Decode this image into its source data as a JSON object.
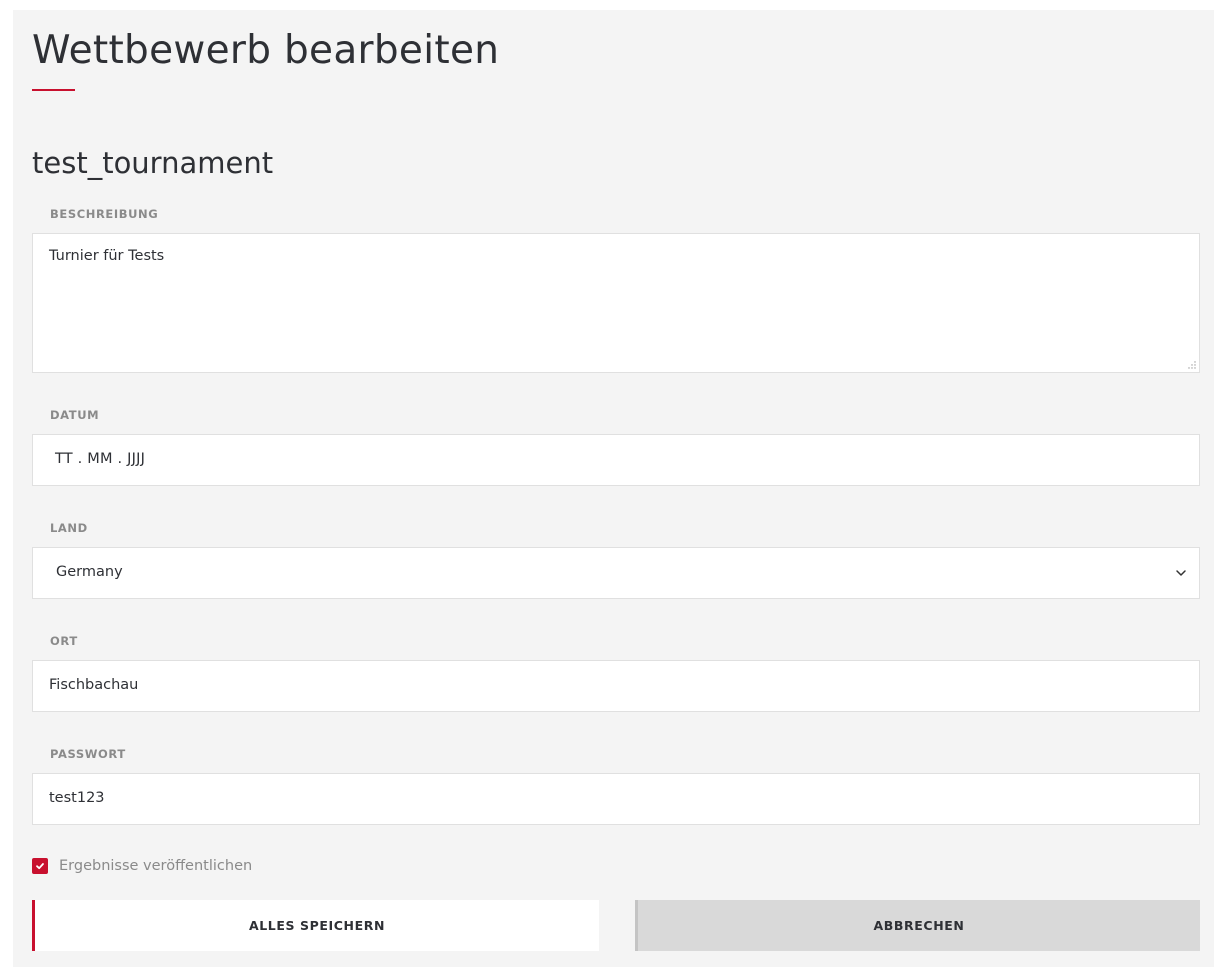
{
  "header": {
    "title": "Wettbewerb bearbeiten"
  },
  "form": {
    "name": "test_tournament",
    "description": {
      "label": "BESCHREIBUNG",
      "value": "Turnier für Tests"
    },
    "date": {
      "label": "DATUM",
      "placeholder": "TT . MM . JJJJ"
    },
    "country": {
      "label": "LAND",
      "selected": "Germany"
    },
    "city": {
      "label": "ORT",
      "value": "Fischbachau"
    },
    "password": {
      "label": "PASSWORT",
      "value": "test123"
    },
    "publish_results": {
      "label": "Ergebnisse veröffentlichen",
      "checked": true
    }
  },
  "actions": {
    "save_label": "ALLES SPEICHERN",
    "cancel_label": "ABBRECHEN"
  },
  "colors": {
    "accent": "#c8102e",
    "panel_bg": "#f4f4f4",
    "cancel_bg": "#d9d9d9"
  }
}
